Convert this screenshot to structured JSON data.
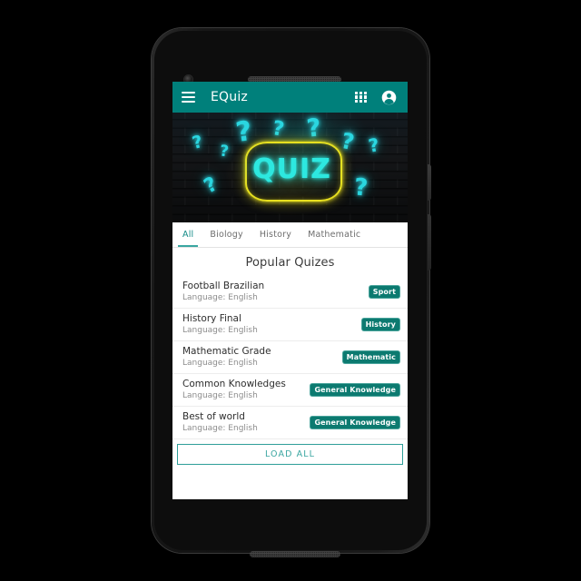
{
  "appbar": {
    "title": "EQuiz",
    "menu_icon": "hamburger-menu-icon",
    "apps_icon": "apps-grid-icon",
    "account_icon": "account-circle-icon",
    "background_color": "#00807b"
  },
  "banner": {
    "neon_text": "QUIZ",
    "question_marks": [
      "?",
      "?",
      "?",
      "?",
      "?",
      "?",
      "?",
      "?",
      "?"
    ],
    "neon_cyan": "#2de8e0",
    "neon_yellow": "#e8e020",
    "wall_color": "#1d1f22"
  },
  "tabs": [
    {
      "label": "All",
      "active": true
    },
    {
      "label": "Biology",
      "active": false
    },
    {
      "label": "History",
      "active": false
    },
    {
      "label": "Mathematic",
      "active": false
    }
  ],
  "content": {
    "section_title": "Popular Quizes",
    "quizzes": [
      {
        "title": "Football Brazilian",
        "subtitle": "Language: English",
        "badge": "Sport"
      },
      {
        "title": "History Final",
        "subtitle": "Language: English",
        "badge": "History"
      },
      {
        "title": "Mathematic Grade",
        "subtitle": "Language: English",
        "badge": "Mathematic"
      },
      {
        "title": "Common Knowledges",
        "subtitle": "Language: English",
        "badge": "General Knowledge"
      },
      {
        "title": "Best of world",
        "subtitle": "Language: English",
        "badge": "General Knowledge"
      }
    ],
    "load_all_label": "LOAD ALL",
    "badge_color": "#0c7a70",
    "accent_color": "#3aa6a1"
  }
}
